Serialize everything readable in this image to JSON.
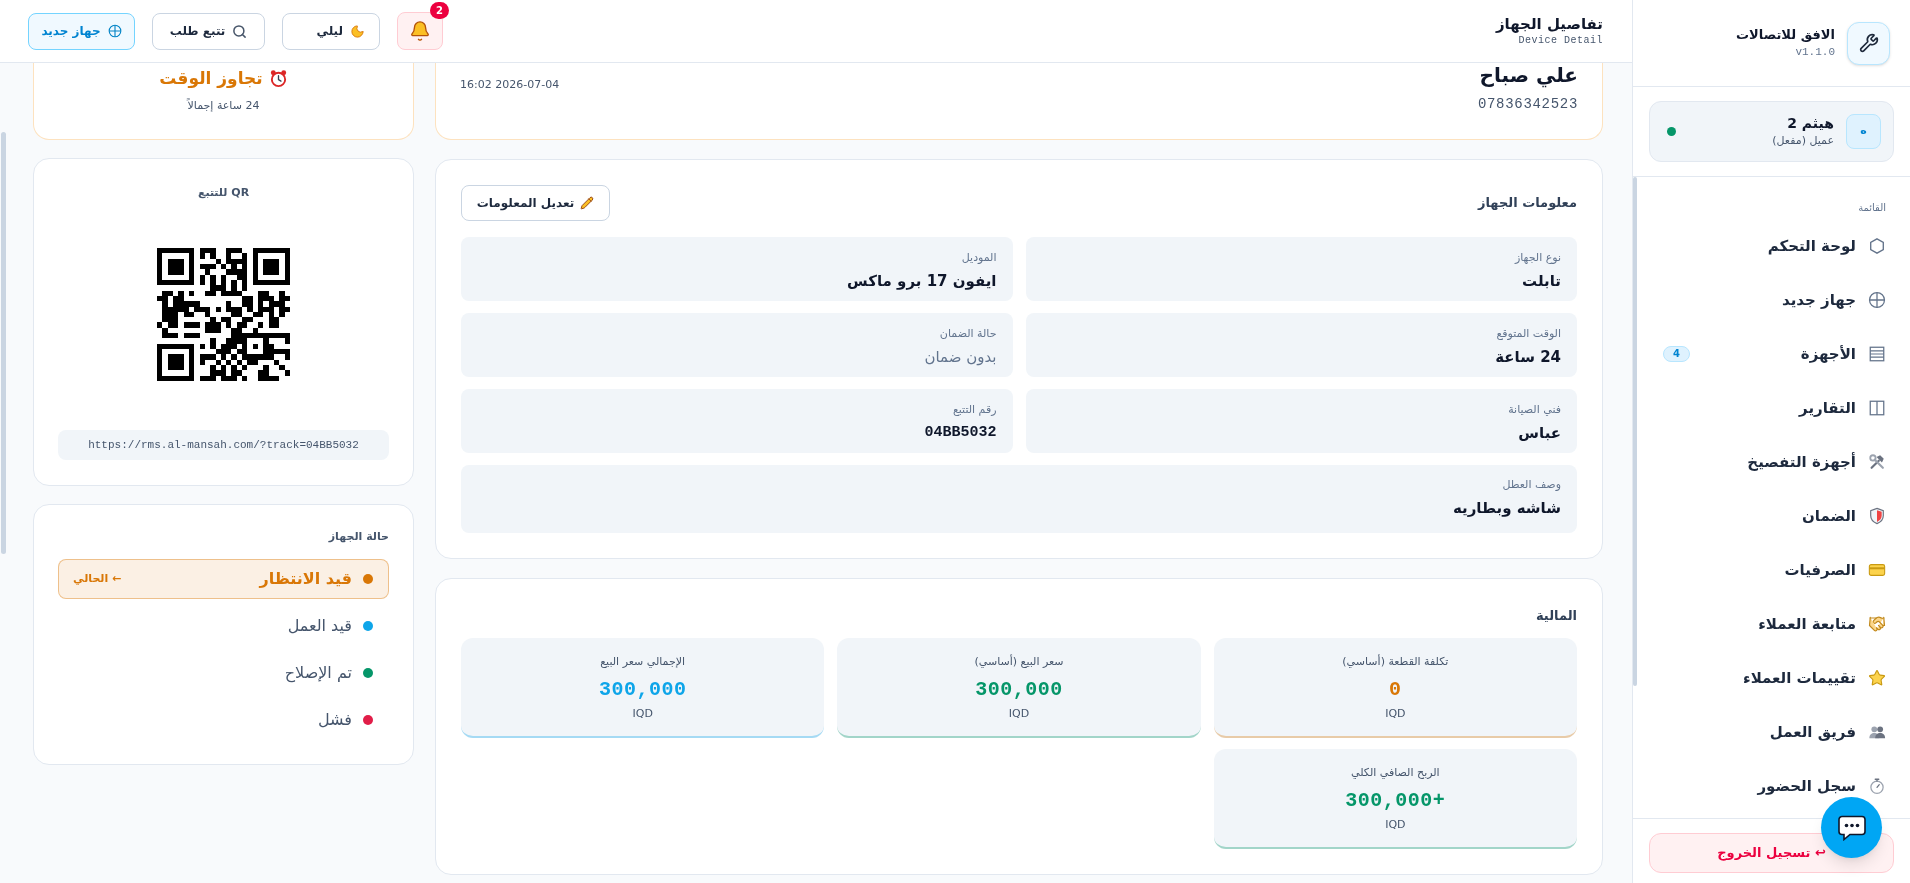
{
  "sidebar": {
    "brand": {
      "name": "الافق للاتصالات",
      "version": "v1.1.0"
    },
    "user": {
      "avatar": "ه",
      "name": "هيثم 2",
      "role": "عميل (مفعل)",
      "online": true
    },
    "menu_title": "القائمة",
    "items": [
      {
        "label": "لوحة التحكم",
        "selected": false
      },
      {
        "label": "جهاز جديد",
        "selected": false
      },
      {
        "label": "الأجهزة",
        "badge": "4",
        "selected": false
      },
      {
        "label": "التقارير",
        "selected": false
      },
      {
        "label": "أجهزة التفصيخ",
        "selected": false
      },
      {
        "label": "الضمان",
        "selected": false
      },
      {
        "label": "الصرفيات",
        "selected": false
      },
      {
        "label": "متابعة العملاء",
        "selected": false
      },
      {
        "label": "تقييمات العملاء",
        "selected": false
      },
      {
        "label": "فريق العمل",
        "selected": false
      },
      {
        "label": "سجل الحضور",
        "selected": false
      }
    ],
    "logout": "↩ تسجيل الخروج"
  },
  "header": {
    "title": "تفاصيل الجهاز",
    "subtitle": "Device Detail",
    "notifications": {
      "count": "2"
    },
    "buttons": [
      {
        "kind": "theme",
        "label": "ليلي"
      },
      {
        "kind": "track",
        "label": "تتبع طلب"
      },
      {
        "kind": "new",
        "label": "جهاز جديد"
      }
    ]
  },
  "summary": {
    "customer": "علي صباح",
    "phone": "07836342523",
    "date": "2026-07-04 16:02"
  },
  "timer": {
    "status": "تجاوز الوقت",
    "total": "24 ساعة إجمالاً"
  },
  "device_info": {
    "title": "معلومات الجهاز",
    "edit_button": "تعديل المعلومات",
    "fields": [
      {
        "label": "نوع الجهاز",
        "value": "تابلت",
        "kind": "text"
      },
      {
        "label": "الموديل",
        "value": "ايفون 17 برو ماكس",
        "kind": "text"
      },
      {
        "label": "الوقت المتوقع",
        "value": "24 ساعة",
        "kind": "text"
      },
      {
        "label": "حالة الضمان",
        "value": "بدون ضمان",
        "kind": "muted"
      },
      {
        "label": "فني الصيانة",
        "value": "عباس",
        "kind": "text"
      },
      {
        "label": "رقم التتبع",
        "value": "04BB5032",
        "kind": "code"
      },
      {
        "label": "وصف العطل",
        "value": "شاشه وبطاريه",
        "kind": "wide"
      }
    ]
  },
  "finance": {
    "title": "المالية",
    "items": [
      {
        "label": "تكلفة القطعة (أساسي)",
        "value": "0",
        "currency": "IQD",
        "color": "#d97706"
      },
      {
        "label": "سعر البيع (أساسي)",
        "value": "300,000",
        "currency": "IQD",
        "color": "#059669"
      },
      {
        "label": "الإجمالي سعر البيع",
        "value": "300,000",
        "currency": "IQD",
        "color": "#0ea5e9"
      },
      {
        "label": "الربح الصافي الكلي",
        "value": "+300,000",
        "currency": "IQD",
        "color": "#059669"
      }
    ]
  },
  "qr": {
    "title": "QR للتتبع",
    "url": "https://rms.al-mansah.com/?track=04BB5032"
  },
  "status": {
    "title": "حالة الجهاز",
    "current_marker": "← الحالي",
    "items": [
      {
        "label": "قيد الانتظار",
        "color": "#d97706",
        "selected": true
      },
      {
        "label": "قيد العمل",
        "color": "#0ea5e9",
        "selected": false
      },
      {
        "label": "تم الإصلاح",
        "color": "#059669",
        "selected": false
      },
      {
        "label": "فشل",
        "color": "#e11d48",
        "selected": false
      }
    ]
  }
}
